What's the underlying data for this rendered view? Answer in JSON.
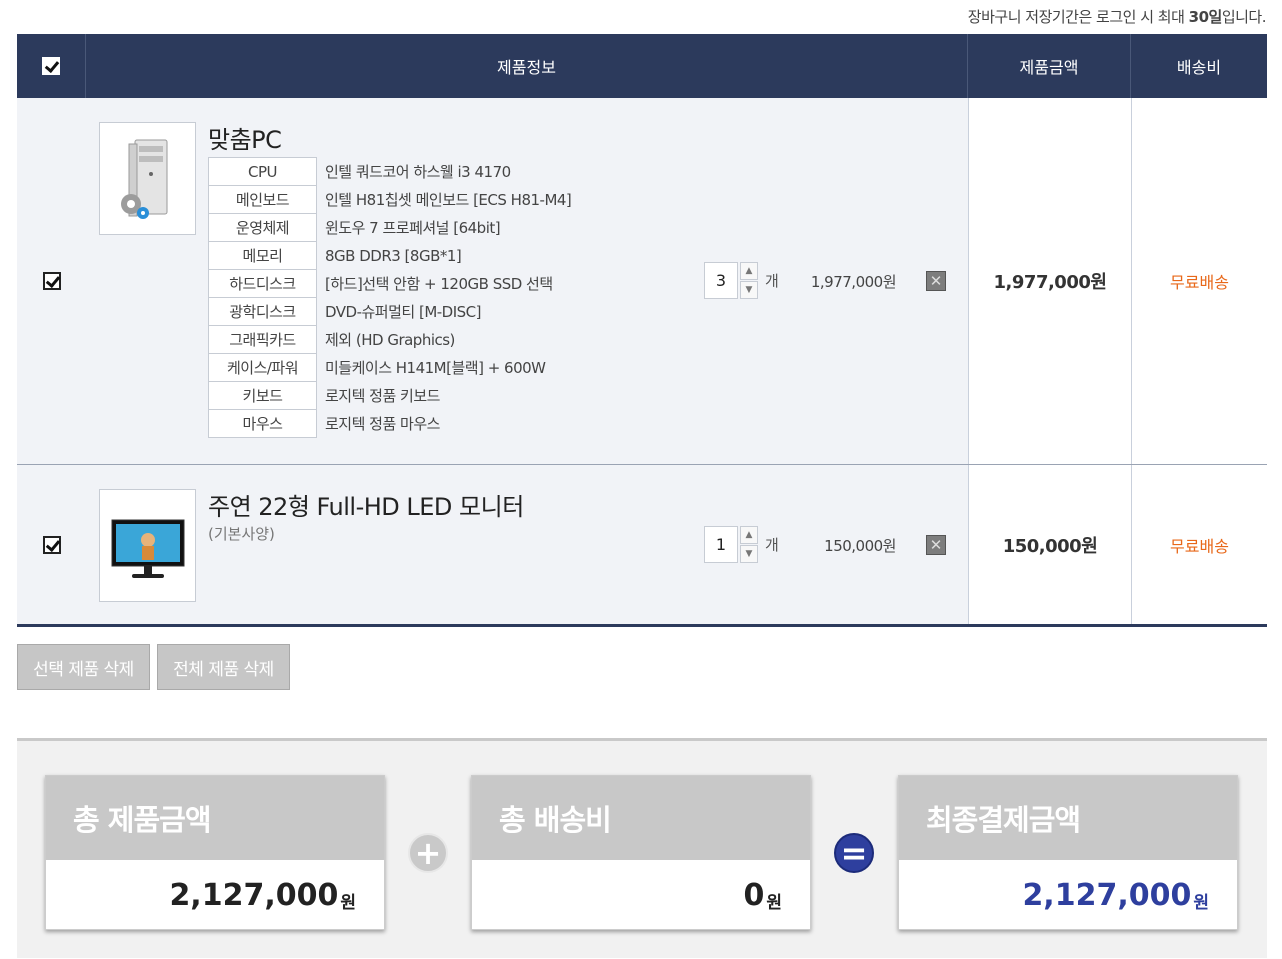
{
  "notice": {
    "prefix": "장바구니 저장기간은 로그인 시 최대 ",
    "bold": "30일",
    "suffix": "입니다."
  },
  "table": {
    "headers": {
      "info": "제품정보",
      "price": "제품금액",
      "shipping": "배송비"
    }
  },
  "items": [
    {
      "name": "맞춤PC",
      "specs": [
        {
          "key": "CPU",
          "value": "인텔 쿼드코어 하스웰 i3 4170"
        },
        {
          "key": "메인보드",
          "value": "인텔 H81칩셋 메인보드 [ECS H81-M4]"
        },
        {
          "key": "운영체제",
          "value": "윈도우 7 프로페셔널 [64bit]"
        },
        {
          "key": "메모리",
          "value": "8GB DDR3 [8GB*1]"
        },
        {
          "key": "하드디스크",
          "value": "[하드]선택 안함 + 120GB SSD 선택"
        },
        {
          "key": "광학디스크",
          "value": "DVD-슈퍼멀티 [M-DISC]"
        },
        {
          "key": "그래픽카드",
          "value": "제외 (HD Graphics)"
        },
        {
          "key": "케이스/파워",
          "value": "미들케이스 H141M[블랙] + 600W"
        },
        {
          "key": "키보드",
          "value": "로지텍 정품 키보드"
        },
        {
          "key": "마우스",
          "value": "로지텍 정품 마우스"
        }
      ],
      "qty": "3",
      "unit": "개",
      "unit_price": "1,977,000원",
      "price": "1,977,000원",
      "shipping": "무료배송",
      "thumb_icon": "pc-tower-icon"
    },
    {
      "name": "주연 22형 Full-HD LED 모니터",
      "sub": "(기본사양)",
      "qty": "1",
      "unit": "개",
      "unit_price": "150,000원",
      "price": "150,000원",
      "shipping": "무료배송",
      "thumb_icon": "monitor-icon"
    }
  ],
  "buttons": {
    "delete_selected": "선택 제품 삭제",
    "delete_all": "전체 제품 삭제"
  },
  "summary": {
    "total_product": {
      "label": "총 제품금액",
      "value": "2,127,000",
      "unit": "원"
    },
    "total_shipping": {
      "label": "총 배송비",
      "value": "0",
      "unit": "원"
    },
    "final": {
      "label": "최종결제금액",
      "value": "2,127,000",
      "unit": "원"
    },
    "plus_symbol": "+",
    "equals_symbol": "="
  },
  "colors": {
    "header": "#2c3a5c",
    "shipping": "#e8681a",
    "final_total": "#2e3f9e"
  }
}
